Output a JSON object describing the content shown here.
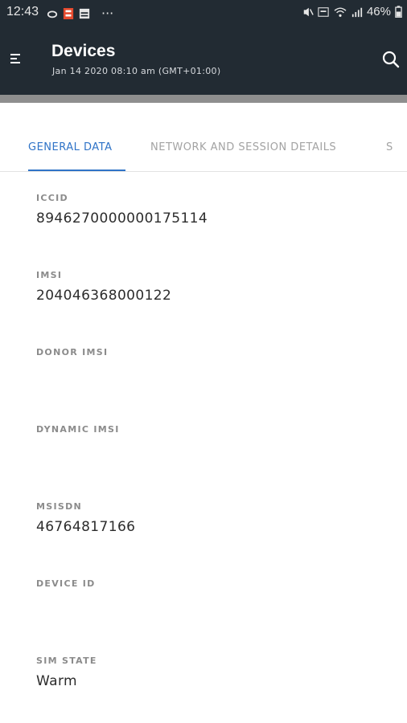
{
  "status_bar": {
    "time": "12:43",
    "more": "···",
    "battery": "46%",
    "icons": [
      "cloud-icon",
      "notification-icon",
      "image-icon",
      "mute-icon",
      "volte-icon",
      "wifi-icon",
      "signal-icon",
      "battery-icon"
    ]
  },
  "app_bar": {
    "title": "Devices",
    "subtitle": "Jan 14 2020 08:10 am (GMT+01:00)",
    "icons": [
      "menu-icon",
      "search-icon"
    ]
  },
  "tabs": [
    {
      "label": "GENERAL DATA",
      "active": true
    },
    {
      "label": "NETWORK AND SESSION DETAILS",
      "active": false
    },
    {
      "label": "S",
      "active": false
    }
  ],
  "fields": [
    {
      "label": "ICCID",
      "value": "8946270000000175114"
    },
    {
      "label": "IMSI",
      "value": "204046368000122"
    },
    {
      "label": "DONOR IMSI",
      "value": ""
    },
    {
      "label": "DYNAMIC IMSI",
      "value": ""
    },
    {
      "label": "MSISDN",
      "value": "46764817166"
    },
    {
      "label": "DEVICE ID",
      "value": ""
    },
    {
      "label": "SIM STATE",
      "value": "Warm"
    }
  ],
  "colors": {
    "app_bar": "#222b33",
    "accent": "#2f73c7",
    "inactive_tab": "#a3a3a3"
  }
}
